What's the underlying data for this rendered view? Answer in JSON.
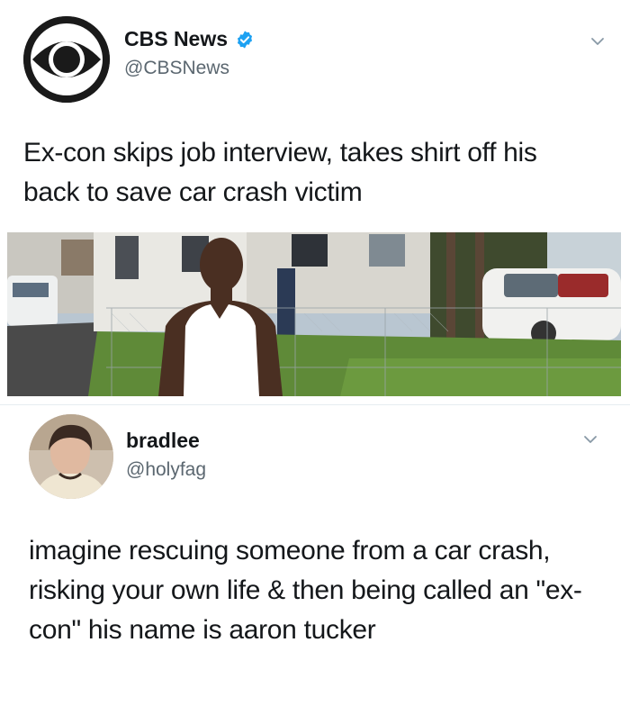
{
  "tweets": [
    {
      "author_name": "CBS News",
      "verified": true,
      "handle": "@CBSNews",
      "text": "Ex-con skips job interview, takes shirt off his back to save car crash victim",
      "avatar_icon": "cbs-eye-logo",
      "menu_icon": "chevron-down-icon",
      "has_media": true
    },
    {
      "author_name": "bradlee",
      "verified": false,
      "handle": "@holyfag",
      "text": "imagine rescuing someone from a car crash, risking your own life & then being called an \"ex-con\" his name is aaron tucker",
      "avatar_icon": "user-avatar",
      "menu_icon": "chevron-down-icon"
    }
  ],
  "colors": {
    "verified_blue": "#1da1f2",
    "text": "#14171a",
    "secondary_text": "#5b6770",
    "divider": "#e6ecf0"
  }
}
